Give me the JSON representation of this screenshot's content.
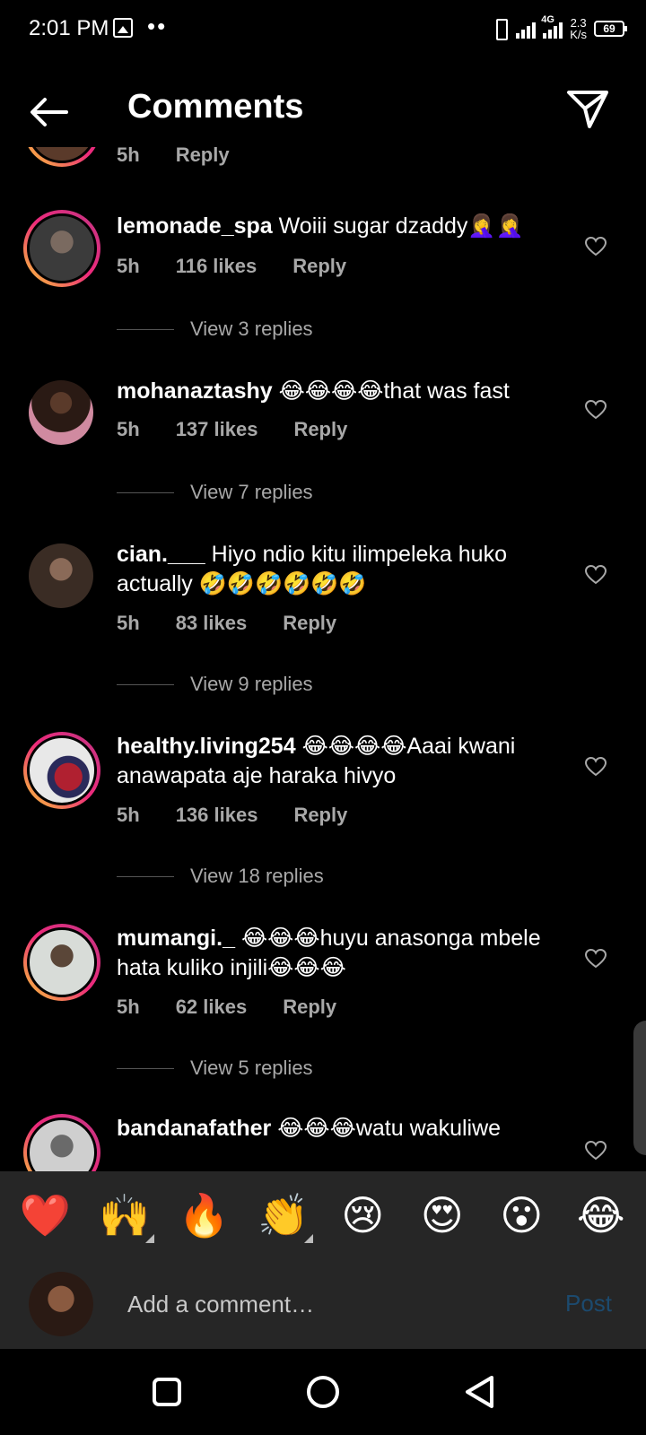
{
  "status_bar": {
    "time": "2:01 PM",
    "dots": "••",
    "network": "4G",
    "speed_value": "2.3",
    "speed_unit": "K/s",
    "battery": "69"
  },
  "header": {
    "title": "Comments",
    "back_icon": "arrow-left-icon",
    "send_icon": "paper-plane-icon"
  },
  "partial_comment": {
    "time": "5h",
    "reply": "Reply"
  },
  "comments": [
    {
      "user": "lemonade_spa",
      "text": "Woiii sugar dzaddy🤦‍♀️🤦‍♀️",
      "time": "5h",
      "likes": "116 likes",
      "reply": "Reply",
      "view_replies": "View 3 replies",
      "avatar_colors": [
        "#3b3b3b",
        "#7a6a60"
      ]
    },
    {
      "user": "mohanaztashy",
      "text": "😂😂😂😂that was fast",
      "time": "5h",
      "likes": "137 likes",
      "reply": "Reply",
      "view_replies": "View 7 replies",
      "avatar_colors": [
        "#2a1a14",
        "#d08aa0"
      ]
    },
    {
      "user": "cian.___",
      "text": "Hiyo ndio kitu ilimpeleka huko actually 🤣🤣🤣🤣🤣🤣",
      "time": "5h",
      "likes": "83 likes",
      "reply": "Reply",
      "view_replies": "View 9 replies",
      "avatar_colors": [
        "#3a2c24",
        "#8a6a58"
      ]
    },
    {
      "user": "healthy.living254",
      "text": "😂😂😂😂Aaai kwani anawapata aje haraka hivyo",
      "time": "5h",
      "likes": "136 likes",
      "reply": "Reply",
      "view_replies": "View 18 replies",
      "avatar_colors": [
        "#e8e8e8",
        "#b02030"
      ]
    },
    {
      "user": "mumangi._",
      "text": "😂😂😂huyu anasonga mbele hata kuliko injili😂😂😂",
      "time": "5h",
      "likes": "62 likes",
      "reply": "Reply",
      "view_replies": "View 5 replies",
      "avatar_colors": [
        "#d8dcd8",
        "#5a4638"
      ]
    },
    {
      "user": "bandanafather",
      "text": "😂😂😂watu wakuliwe",
      "time": "",
      "likes": "",
      "reply": "",
      "view_replies": "",
      "avatar_colors": [
        "#cfcfcf",
        "#6a6a6a"
      ]
    }
  ],
  "emoji_bar": [
    "❤️",
    "🙌",
    "🔥",
    "👏",
    "😢",
    "😍",
    "😮",
    "😂"
  ],
  "comment_box": {
    "placeholder": "Add a comment…",
    "post": "Post"
  },
  "colors": {
    "background": "#000000",
    "panel": "#262626",
    "muted_text": "#a8a8a8",
    "post_disabled": "#1c4a6e",
    "story_ring": [
      "#f9ce34",
      "#ee2a7b",
      "#c13584"
    ]
  }
}
